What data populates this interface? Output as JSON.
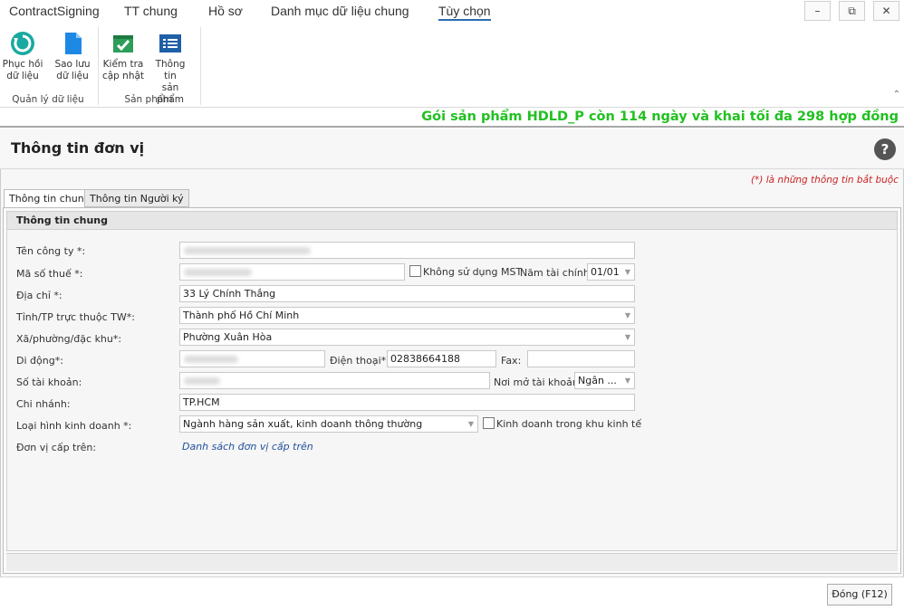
{
  "menu": {
    "items": [
      "ContractSigning",
      "TT chung",
      "Hồ sơ",
      "Danh mục dữ liệu chung",
      "Tùy chọn"
    ],
    "active": "Tùy chọn"
  },
  "window_controls": {
    "minimize": "–",
    "restore": "⧉",
    "close": "✕"
  },
  "ribbon": {
    "groups": [
      {
        "label": "Quản lý dữ liệu",
        "buttons": [
          {
            "label1": "Phục hồi",
            "label2": "dữ liệu",
            "icon": "restore-icon"
          },
          {
            "label1": "Sao lưu",
            "label2": "dữ liệu",
            "icon": "document-icon"
          }
        ]
      },
      {
        "label": "Sản phẩm",
        "buttons": [
          {
            "label1": "Kiểm tra",
            "label2": "cập nhật",
            "icon": "check-update-icon"
          },
          {
            "label1": "Thông tin",
            "label2": "sản phẩm",
            "icon": "product-info-icon"
          }
        ]
      }
    ],
    "collapse_glyph": "⌃"
  },
  "promo_text": "Gói sản phẩm HDLD_P còn 114 ngày và khai tối đa 298 hợp đồng",
  "form": {
    "title": "Thông tin đơn vị",
    "help_glyph": "?",
    "required_note": "(*)  là những thông tin bắt buộc",
    "tabs": [
      "Thông tin chung",
      "Thông tin Người ký"
    ],
    "section_title": "Thông tin chung",
    "fields": {
      "company_name_label": "Tên công ty *:",
      "tax_code_label": "Mã số thuế *:",
      "no_tax_code_label": "Không sử dụng MST",
      "fiscal_year_label": "Năm tài chính:",
      "fiscal_year_value": "01/01",
      "address_label": "Địa chỉ *:",
      "address_value": "33 Lý Chính Thắng",
      "province_label": "Tỉnh/TP trực thuộc TW*:",
      "province_value": "Thành phố Hồ Chí Minh",
      "ward_label": "Xã/phường/đặc khu*:",
      "ward_value": "Phường Xuân Hòa",
      "mobile_label": "Di động*:",
      "phone_label": "Điện thoại*:",
      "phone_value": "02838664188",
      "fax_label": "Fax:",
      "fax_value": "",
      "account_label": "Số tài khoản:",
      "bank_label": "Nơi mở tài khoản:",
      "bank_value": "Ngân ...",
      "branch_label": "Chi nhánh:",
      "branch_value": "TP.HCM",
      "business_type_label": "Loại hình kinh doanh *:",
      "business_type_value": "Ngành hàng sản xuất, kinh doanh thông thường",
      "economic_zone_label": "Kinh doanh trong khu kinh tế",
      "parent_unit_label": "Đơn vị cấp trên:",
      "parent_unit_link": "Danh sách đơn vị cấp trên"
    },
    "close_button": "Đóng (F12)"
  }
}
